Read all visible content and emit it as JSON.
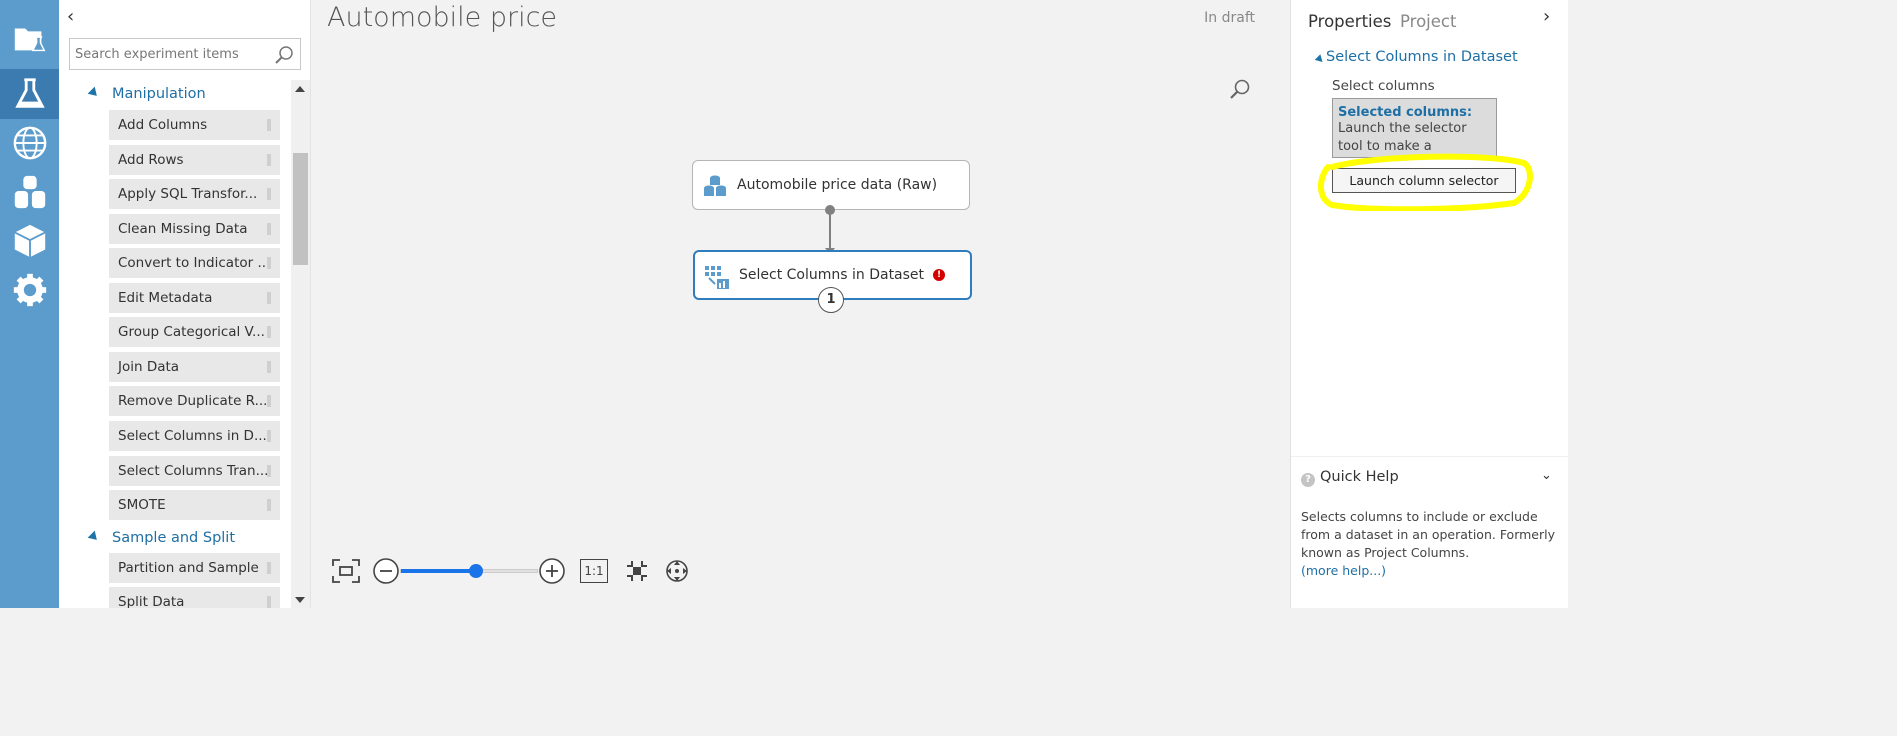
{
  "nav": {
    "items": [
      {
        "icon": "projects-folder-icon"
      },
      {
        "icon": "experiments-flask-icon",
        "active": true
      },
      {
        "icon": "web-services-globe-icon"
      },
      {
        "icon": "datasets-icon"
      },
      {
        "icon": "trained-models-cube-icon"
      },
      {
        "icon": "settings-gear-icon"
      }
    ]
  },
  "palette": {
    "collapse_glyph": "‹",
    "search_placeholder": "Search experiment items",
    "categories": [
      {
        "label": "Manipulation"
      },
      {
        "label": "Sample and Split"
      }
    ],
    "modules": [
      "Add Columns",
      "Add Rows",
      "Apply SQL Transfor...",
      "Clean Missing Data",
      "Convert to Indicator ...",
      "Edit Metadata",
      "Group Categorical V...",
      "Join Data",
      "Remove Duplicate R...",
      "Select Columns in D...",
      "Select Columns Tran...",
      "SMOTE",
      "Partition and Sample",
      "Split Data"
    ]
  },
  "canvas": {
    "title": "Automobile price",
    "status": "In draft",
    "node1_label": "Automobile price data (Raw)",
    "node2_label": "Select Columns in Dataset",
    "node2_error": "!",
    "node2_badge": "1",
    "zoom_level": 0.55,
    "actual_size_label": "1:1"
  },
  "properties": {
    "tab_properties": "Properties",
    "tab_project": "Project",
    "collapse_glyph": "›",
    "section_title": "Select Columns in Dataset",
    "select_columns_label": "Select columns",
    "selected_heading": "Selected columns:",
    "selected_text": "Launch the selector tool to make a selection",
    "launch_button": "Launch column selector",
    "highlight_color": "#ffff00"
  },
  "quick_help": {
    "icon": "?",
    "title": "Quick Help",
    "chevron": "⌄",
    "text": "Selects columns to include or exclude from a dataset in an operation. Formerly known as Project Columns.",
    "link": "(more help...)"
  }
}
